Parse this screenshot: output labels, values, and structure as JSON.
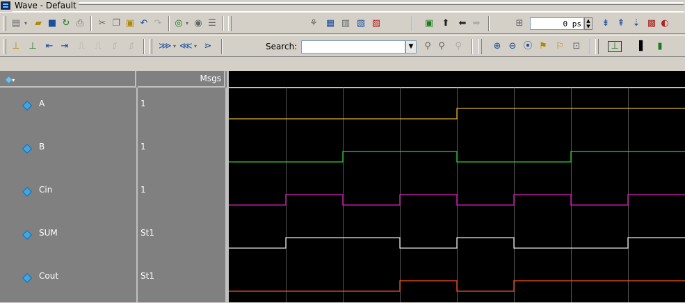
{
  "window": {
    "title": "Wave - Default"
  },
  "toolbar": {
    "time_value": "0 ps",
    "search_label": "Search:",
    "search_placeholder": ""
  },
  "columns": {
    "msgs": "Msgs"
  },
  "signals": [
    {
      "name": "A",
      "value": "1",
      "color": "#e0b020",
      "levels": [
        0,
        0,
        0,
        0,
        1,
        1,
        1,
        1
      ]
    },
    {
      "name": "B",
      "value": "1",
      "color": "#30d030",
      "levels": [
        0,
        0,
        1,
        1,
        0,
        0,
        1,
        1
      ]
    },
    {
      "name": "Cin",
      "value": "1",
      "color": "#e020c0",
      "levels": [
        0,
        1,
        0,
        1,
        0,
        1,
        0,
        1
      ]
    },
    {
      "name": "SUM",
      "value": "St1",
      "color": "#e8e8e8",
      "levels": [
        0,
        1,
        1,
        0,
        1,
        0,
        0,
        1
      ]
    },
    {
      "name": "Cout",
      "value": "St1",
      "color": "#ff5020",
      "levels": [
        0,
        0,
        0,
        1,
        0,
        1,
        1,
        1
      ]
    }
  ],
  "colors": {
    "grid": "#555555",
    "cursor_line": "#c0c0c0",
    "background": "#000000"
  },
  "icons": [
    "new-icon",
    "open-icon",
    "save-icon",
    "reload-icon",
    "print-icon",
    "cut-icon",
    "copy-icon",
    "paste-icon",
    "undo-icon",
    "redo-icon",
    "zoom-icon",
    "find-icon",
    "wave-format-icon",
    "arrow-up-icon",
    "arrow-left-icon",
    "arrow-right-icon",
    "zoom-in-icon",
    "zoom-out-icon",
    "zoom-full-icon"
  ]
}
